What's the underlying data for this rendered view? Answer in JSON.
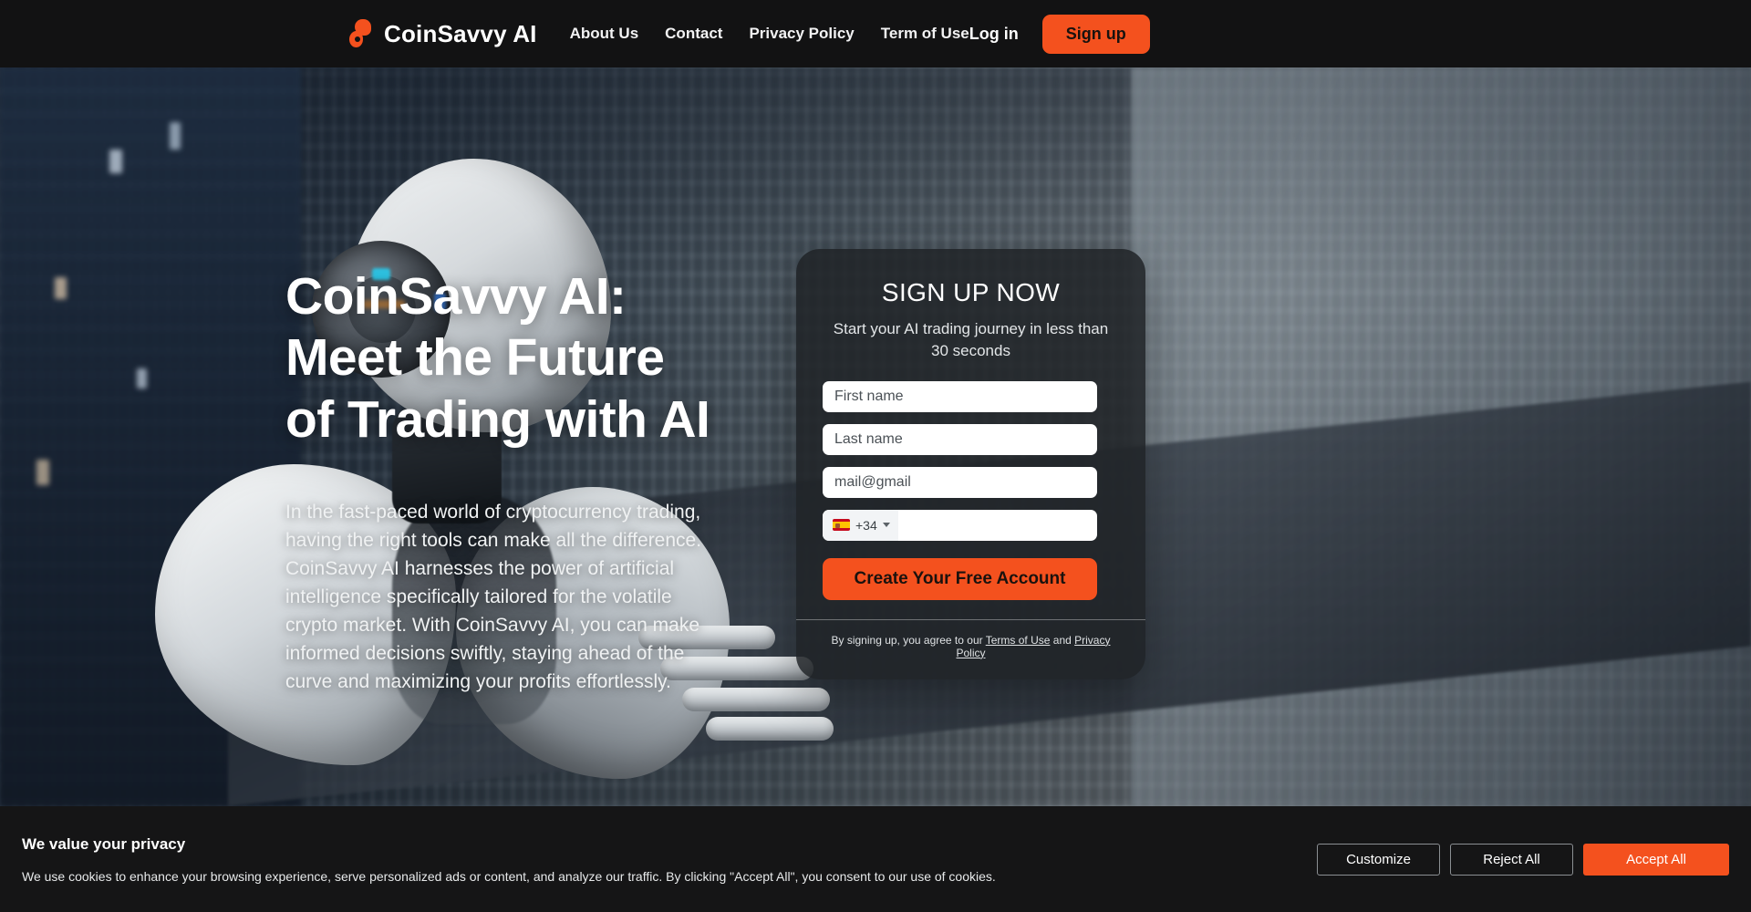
{
  "header": {
    "brand_name": "CoinSavvy AI",
    "logo_icon": "coin-blob-icon",
    "nav": [
      {
        "label": "About Us"
      },
      {
        "label": "Contact"
      },
      {
        "label": "Privacy Policy"
      },
      {
        "label": "Term of Use"
      }
    ],
    "login_label": "Log in",
    "signup_label": "Sign up"
  },
  "hero": {
    "title_line1": "CoinSavvy AI:",
    "title_line2": "Meet the Future",
    "title_line3": "of Trading with AI",
    "paragraph": "In the fast-paced world of cryptocurrency trading, having the right tools can make all the difference. CoinSavvy AI harnesses the power of artificial intelligence specifically tailored for the volatile crypto market. With CoinSavvy AI, you can make informed decisions swiftly, staying ahead of the curve and maximizing your profits effortlessly."
  },
  "signup_card": {
    "title": "SIGN UP NOW",
    "subtitle": "Start your AI trading journey in less than 30 seconds",
    "first_name_placeholder": "First name",
    "last_name_placeholder": "Last name",
    "email_placeholder": "mail@gmail",
    "country_code": "+34",
    "country_flag": "spain-flag-icon",
    "phone_placeholder": "",
    "cta_label": "Create Your Free Account",
    "legal_prefix": "By signing up, you agree to our",
    "legal_terms": "Terms of Use",
    "legal_and": "and",
    "legal_privacy": "Privacy Policy"
  },
  "cookie_banner": {
    "title": "We value your privacy",
    "body": "We use cookies to enhance your browsing experience, serve personalized ads or content, and analyze our traffic. By clicking \"Accept All\", you consent to our use of cookies.",
    "customize_label": "Customize",
    "reject_label": "Reject All",
    "accept_label": "Accept All"
  },
  "colors": {
    "accent_orange": "#f4511e",
    "header_bg": "#121213",
    "cookie_bg": "#151516",
    "card_bg": "rgba(32,35,38,.86)"
  }
}
